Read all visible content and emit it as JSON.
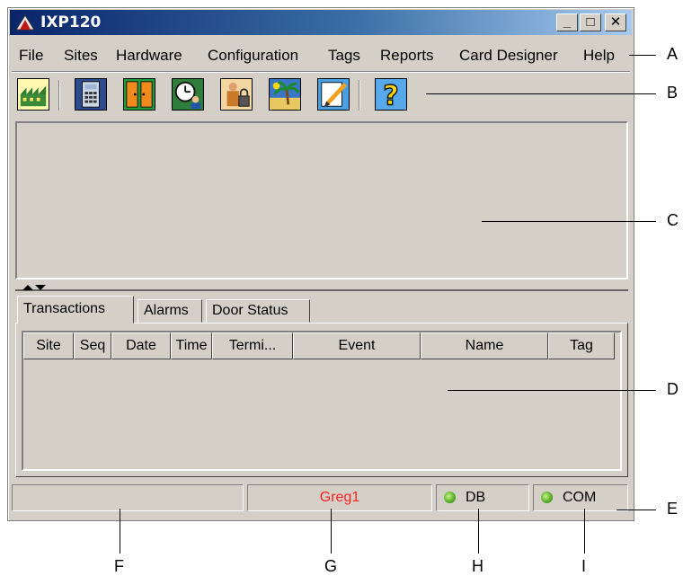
{
  "window": {
    "title": "IXP120"
  },
  "titlebar_buttons": [
    "_",
    "□",
    "✕"
  ],
  "menu": [
    "File",
    "Sites",
    "Hardware",
    "Configuration",
    "Tags",
    "Reports",
    "Card Designer",
    "Help"
  ],
  "toolbar": [
    {
      "name": "sites-icon"
    },
    {
      "name": "controller-icon"
    },
    {
      "name": "door-icon"
    },
    {
      "name": "time-user-icon"
    },
    {
      "name": "user-lock-icon"
    },
    {
      "name": "holiday-icon"
    },
    {
      "name": "edit-icon"
    },
    {
      "name": "help-icon"
    }
  ],
  "tabs": [
    "Transactions",
    "Alarms",
    "Door Status"
  ],
  "columns": [
    "Site",
    "Seq",
    "Date",
    "Time",
    "Termi...",
    "Event",
    "Name",
    "Tag"
  ],
  "status": {
    "user": "Greg1",
    "user_color": "#ff2020",
    "db": "DB",
    "com": "COM",
    "led_color": "#5bb02a"
  },
  "callouts": [
    "A",
    "B",
    "C",
    "D",
    "E",
    "F",
    "G",
    "H",
    "I"
  ]
}
